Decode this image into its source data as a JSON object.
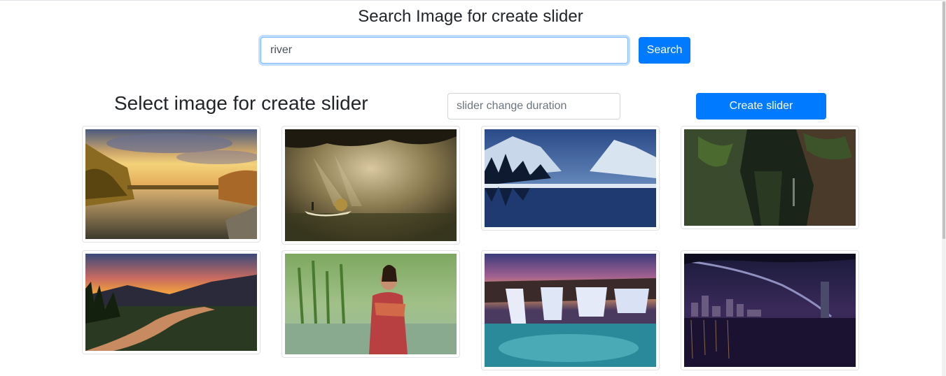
{
  "search": {
    "title": "Search Image for create slider",
    "query": "river",
    "button_label": "Search"
  },
  "slider": {
    "title": "Select image for create slider",
    "duration_placeholder": "slider change duration",
    "create_button_label": "Create slider"
  },
  "colors": {
    "primary": "#007bff"
  },
  "images": [
    {
      "name": "river-sunset-autumn-image"
    },
    {
      "name": "boat-in-fog-light-rays-image"
    },
    {
      "name": "snowy-mountains-lake-reflection-image"
    },
    {
      "name": "canyon-waterfall-green-image"
    },
    {
      "name": "river-valley-dusk-image"
    },
    {
      "name": "woman-in-water-image"
    },
    {
      "name": "waterfall-sunset-image"
    },
    {
      "name": "bridge-night-city-image"
    }
  ]
}
